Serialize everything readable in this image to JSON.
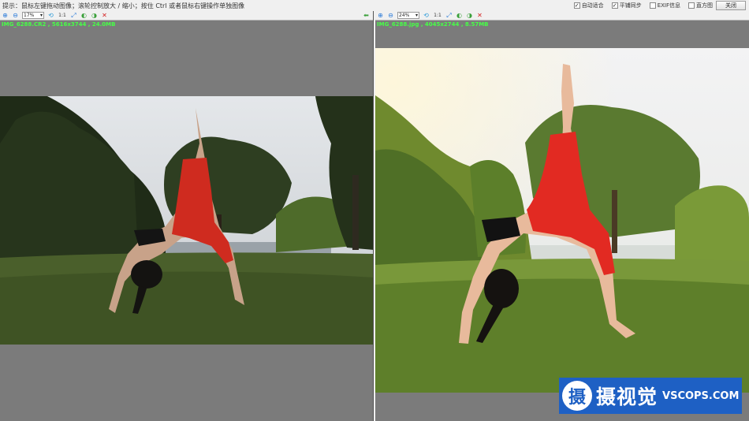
{
  "hint": "提示：鼠标左键拖动图像；滚轮控制放大 / 缩小；按住 Ctrl 或者鼠标右键操作单独图像",
  "options": [
    {
      "label": "自动适合",
      "checked": true
    },
    {
      "label": "平铺同步",
      "checked": true
    },
    {
      "label": "EXIF信息",
      "checked": false
    },
    {
      "label": "直方图",
      "checked": false
    }
  ],
  "close_label": "关闭",
  "left": {
    "zoom": "17%",
    "file_info": "IMG_6288.CR2 , 5616x3744 , 24.0MB",
    "one_to_one": "1:1"
  },
  "right": {
    "zoom": "24%",
    "file_info": "IMG_6288.jpg , 4045x2744 , 8.57MB",
    "one_to_one": "1:1"
  },
  "icons": {
    "zoom_in": "zoom-in-icon",
    "zoom_out": "zoom-out-icon",
    "rotate": "rotate-icon",
    "fit": "fit-icon",
    "prev": "prev-icon",
    "next": "next-icon",
    "delete": "delete-icon",
    "back": "back-arrow-icon"
  },
  "watermark": {
    "logo": "摄",
    "name": "摄视觉",
    "site": "VSCOPS.COM"
  }
}
